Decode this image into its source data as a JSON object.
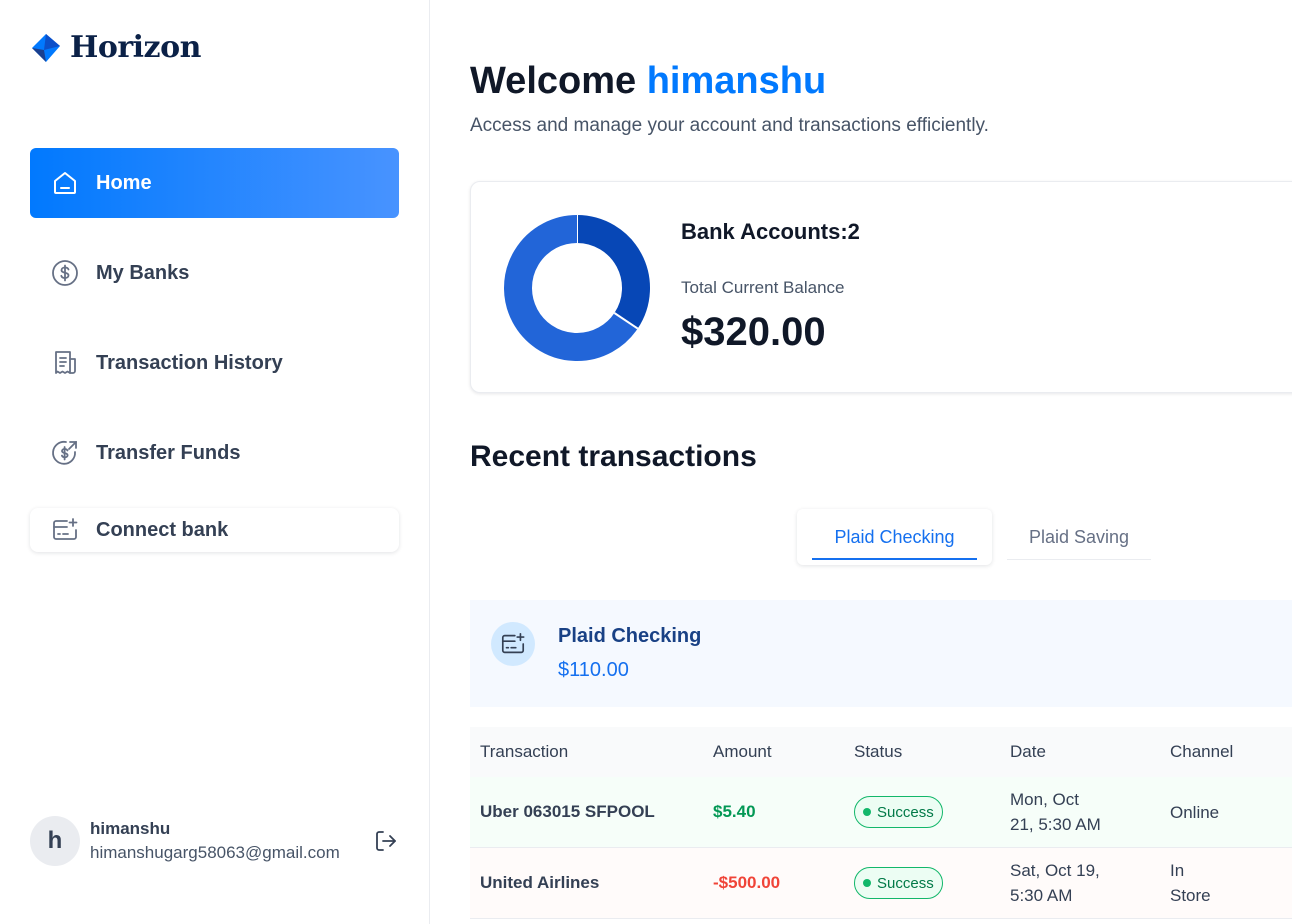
{
  "brand": {
    "name": "Horizon"
  },
  "sidebar": {
    "items": [
      {
        "label": "Home",
        "icon": "home-icon",
        "active": true
      },
      {
        "label": "My Banks",
        "icon": "dollar-circle-icon"
      },
      {
        "label": "Transaction History",
        "icon": "receipt-icon"
      },
      {
        "label": "Transfer Funds",
        "icon": "transfer-dollar-icon"
      }
    ],
    "connect_label": "Connect bank"
  },
  "user": {
    "initial": "h",
    "name": "himanshu",
    "email": "himanshugarg58063@gmail.com"
  },
  "header": {
    "welcome_prefix": "Welcome",
    "user_name": "himanshu",
    "subtitle": "Access and manage your account and transactions efficiently."
  },
  "balance": {
    "bank_accounts_label": "Bank Accounts:",
    "bank_accounts_count": "2",
    "total_label": "Total Current Balance",
    "total_value": "$320.00",
    "donut": [
      {
        "name": "Plaid Checking",
        "value": 110,
        "color": "#0747b6"
      },
      {
        "name": "Plaid Saving",
        "value": 210,
        "color": "#2265d8"
      }
    ]
  },
  "recent": {
    "title": "Recent transactions",
    "tabs": [
      "Plaid Checking",
      "Plaid Saving"
    ],
    "bank": {
      "name": "Plaid Checking",
      "amount": "$110.00"
    },
    "columns": [
      "Transaction",
      "Amount",
      "Status",
      "Date",
      "Channel"
    ],
    "rows": [
      {
        "name": "Uber 063015 SFPOOL",
        "amount": "$5.40",
        "type": "credit",
        "status": "Success",
        "date_line1": "Mon, Oct",
        "date_line2": "21, 5:30 AM",
        "channel_line1": "Online",
        "channel_line2": ""
      },
      {
        "name": "United Airlines",
        "amount": "-$500.00",
        "type": "debit",
        "status": "Success",
        "date_line1": "Sat, Oct 19,",
        "date_line2": "5:30 AM",
        "channel_line1": "In",
        "channel_line2": "Store"
      }
    ]
  },
  "colors": {
    "accent": "#0179fe",
    "success": "#12b76a",
    "debit": "#f04438"
  }
}
